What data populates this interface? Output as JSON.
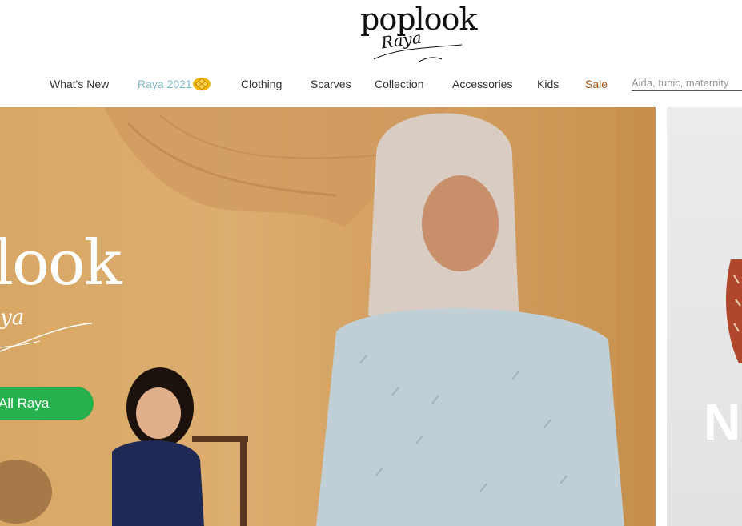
{
  "brand": {
    "logo_main": "poplook",
    "logo_script": "Raya"
  },
  "nav": {
    "items": [
      {
        "label": "What's New"
      },
      {
        "label": "Raya 2021"
      },
      {
        "label": "Clothing"
      },
      {
        "label": "Scarves"
      },
      {
        "label": "Collection"
      },
      {
        "label": "Accessories"
      },
      {
        "label": "Kids"
      },
      {
        "label": "Sale"
      }
    ],
    "raya_icon": "ketupat-icon"
  },
  "search": {
    "placeholder": "Aida, tunic, maternity"
  },
  "hero": {
    "headline": "look",
    "script": "ya",
    "cta_label": "All Raya"
  },
  "side_banner": {
    "letter": "N"
  },
  "colors": {
    "cta": "#27b14e",
    "raya_nav": "#7fb7c9",
    "sale_nav": "#a8581d"
  }
}
